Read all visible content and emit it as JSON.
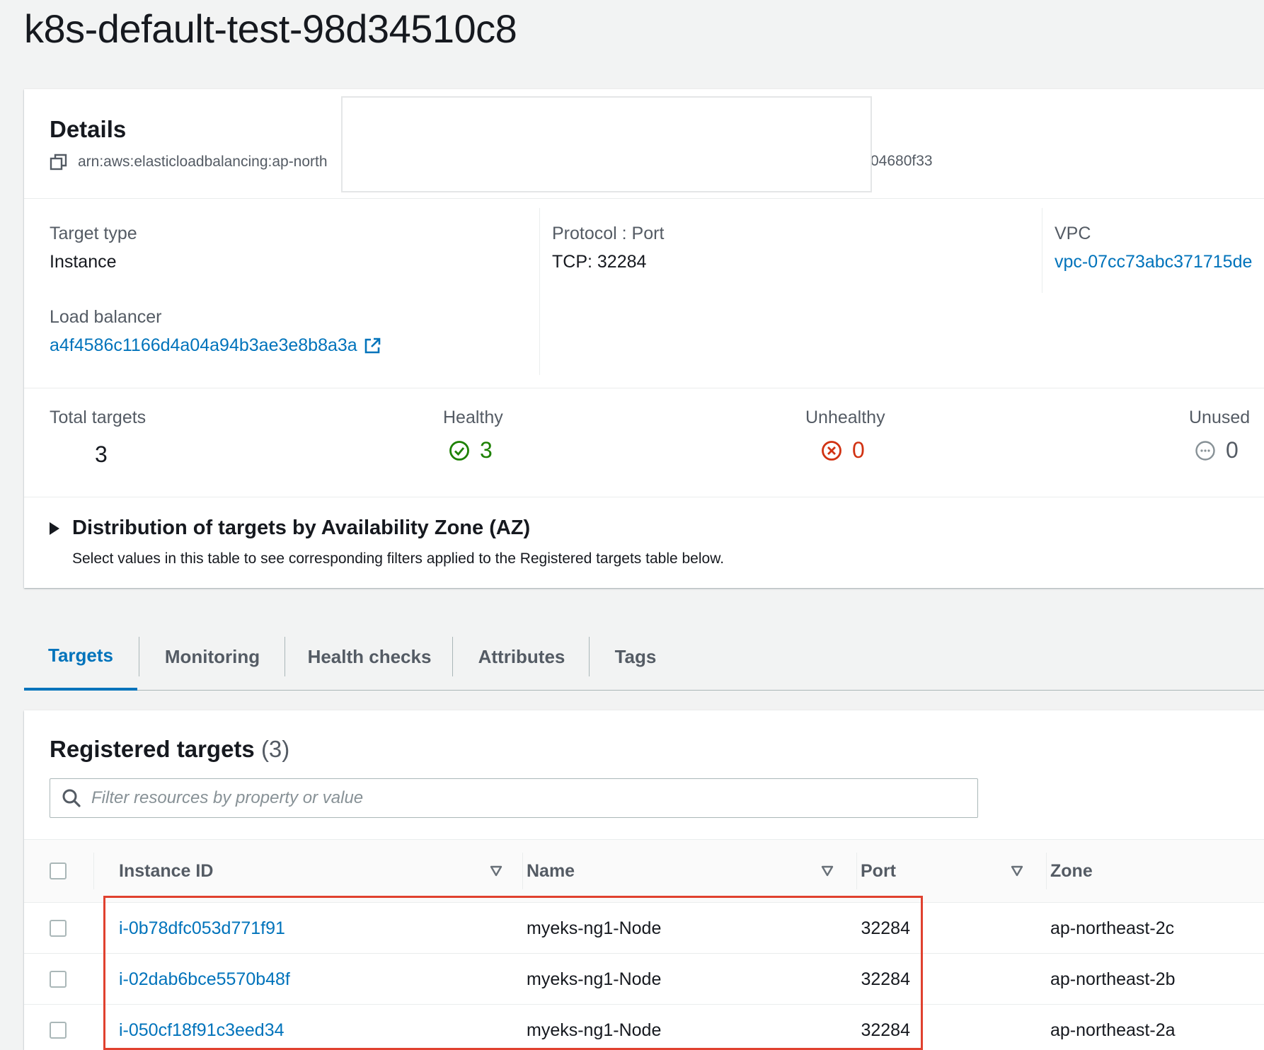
{
  "page": {
    "title": "k8s-default-test-98d34510c8"
  },
  "details": {
    "title": "Details",
    "arn_prefix": "arn:aws:elasticloadbalancing:ap-north",
    "arn_suffix": "04680f33",
    "fields": {
      "target_type": {
        "label": "Target type",
        "value": "Instance"
      },
      "protocol_port": {
        "label": "Protocol : Port",
        "value": "TCP: 32284"
      },
      "vpc": {
        "label": "VPC",
        "value": "vpc-07cc73abc371715de"
      },
      "load_balancer": {
        "label": "Load balancer",
        "value": "a4f4586c1166d4a04a94b3ae3e8b8a3a"
      }
    },
    "counts": {
      "total": {
        "label": "Total targets",
        "value": "3"
      },
      "healthy": {
        "label": "Healthy",
        "value": "3"
      },
      "unhealthy": {
        "label": "Unhealthy",
        "value": "0"
      },
      "unused": {
        "label": "Unused",
        "value": "0"
      }
    },
    "az": {
      "title": "Distribution of targets by Availability Zone (AZ)",
      "description": "Select values in this table to see corresponding filters applied to the Registered targets table below."
    }
  },
  "tabs": [
    {
      "label": "Targets",
      "active": true
    },
    {
      "label": "Monitoring",
      "active": false
    },
    {
      "label": "Health checks",
      "active": false
    },
    {
      "label": "Attributes",
      "active": false
    },
    {
      "label": "Tags",
      "active": false
    }
  ],
  "registered_targets": {
    "title": "Registered targets",
    "count": "(3)",
    "search_placeholder": "Filter resources by property or value",
    "columns": [
      "Instance ID",
      "Name",
      "Port",
      "Zone"
    ],
    "rows": [
      {
        "instance_id": "i-0b78dfc053d771f91",
        "name": "myeks-ng1-Node",
        "port": "32284",
        "zone": "ap-northeast-2c"
      },
      {
        "instance_id": "i-02dab6bce5570b48f",
        "name": "myeks-ng1-Node",
        "port": "32284",
        "zone": "ap-northeast-2b"
      },
      {
        "instance_id": "i-050cf18f91c3eed34",
        "name": "myeks-ng1-Node",
        "port": "32284",
        "zone": "ap-northeast-2a"
      }
    ]
  },
  "colors": {
    "link": "#0073bb",
    "healthy": "#1d8102",
    "unhealthy": "#d13212",
    "highlight": "#e0412f"
  },
  "icons": {
    "copy": "copy-icon",
    "external_link": "external-link-icon",
    "healthy": "check-circle-icon",
    "unhealthy": "x-circle-icon",
    "unused": "ellipsis-circle-icon",
    "search": "search-icon",
    "sort": "sort-down-icon",
    "expand": "caret-right-icon"
  }
}
